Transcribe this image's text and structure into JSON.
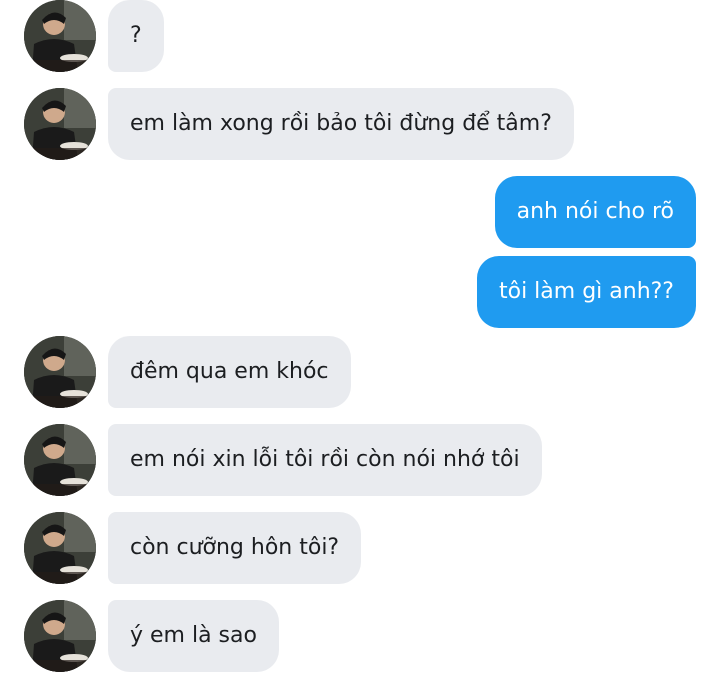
{
  "messages": [
    {
      "side": "in",
      "text": "?"
    },
    {
      "side": "in",
      "text": "em làm xong rồi bảo tôi đừng để tâm?"
    },
    {
      "side": "out",
      "text": "anh nói cho rõ"
    },
    {
      "side": "out",
      "text": "tôi làm gì anh??"
    },
    {
      "side": "in",
      "text": "đêm qua em khóc"
    },
    {
      "side": "in",
      "text": "em nói xin lỗi tôi rồi còn nói nhớ tôi"
    },
    {
      "side": "in",
      "text": "còn cưỡng hôn tôi?"
    },
    {
      "side": "in",
      "text": "ý em là sao"
    }
  ],
  "colors": {
    "incoming_bubble": "#e9ebef",
    "outgoing_bubble": "#1f9bf0",
    "incoming_text": "#1c1e21",
    "outgoing_text": "#ffffff"
  },
  "avatar": {
    "icon": "user-photo-icon"
  }
}
